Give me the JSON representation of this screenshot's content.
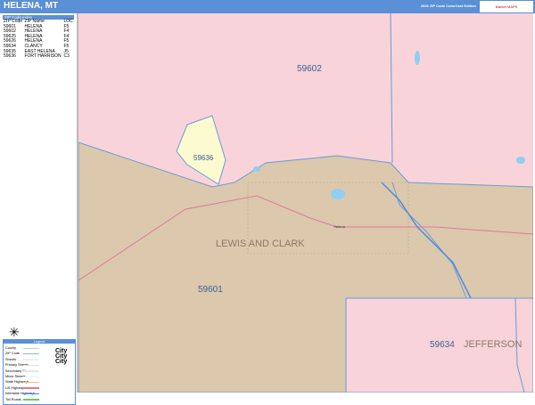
{
  "header": {
    "title": "HELENA, MT",
    "edition": "2026 ZIP Code ColorCast Edition",
    "logo": "Market MAPS"
  },
  "zip_table": {
    "heading": "ZIP Code Index",
    "columns": [
      "ZIP Code",
      "ZIP Name",
      "LOC"
    ],
    "rows": [
      [
        "59601",
        "HELENA",
        "F5"
      ],
      [
        "59602",
        "HELENA",
        "F4"
      ],
      [
        "59625",
        "HELENA",
        "F4"
      ],
      [
        "59626",
        "HELENA",
        "F5"
      ],
      [
        "59634",
        "CLANCY",
        "F5"
      ],
      [
        "59635",
        "EAST HELENA",
        "J5"
      ],
      [
        "59636",
        "FORT HARRISON",
        "C3"
      ]
    ]
  },
  "legend": {
    "heading": "Legend",
    "items": [
      {
        "label": "County",
        "color": "#cccccc"
      },
      {
        "label": "ZIP Code",
        "color": "#8fb4e3"
      },
      {
        "label": "Streets",
        "color": "#eeeeee"
      },
      {
        "label": "Primary Streets",
        "color": "#dddddd"
      },
      {
        "label": "Secondary Streets",
        "color": "#e5e5e5"
      },
      {
        "label": "Minor Streets",
        "color": "#f0f0f0"
      },
      {
        "label": "State Highways",
        "color": "#f5c07a"
      },
      {
        "label": "US Highways",
        "color": "#e07aa0"
      },
      {
        "label": "Interstate Highways",
        "color": "#4a8fe0"
      },
      {
        "label": "Toll Roads",
        "color": "#66cc66"
      }
    ],
    "city_samples": [
      "City",
      "City",
      "City"
    ]
  },
  "map": {
    "labels": {
      "zip_59602": "59602",
      "zip_59636": "59636",
      "county_lewis": "LEWIS AND CLARK",
      "zip_59601": "59601",
      "zip_59634": "59634",
      "county_jefferson": "JEFFERSON",
      "city": "Helena"
    },
    "colors": {
      "pink": "#f8d3da",
      "tan": "#dcc8ad",
      "yellow": "#fcfbd0",
      "water": "#8fd0f0",
      "boundary": "#6b9bd6"
    }
  }
}
